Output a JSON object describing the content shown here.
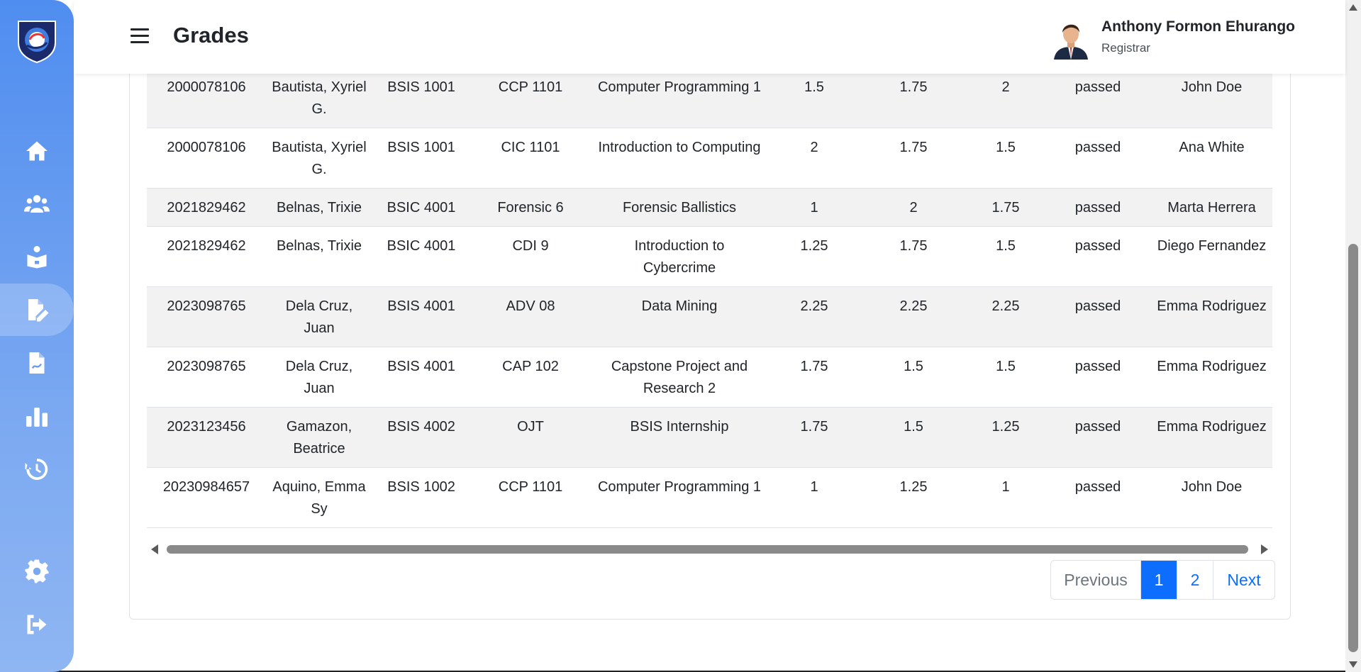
{
  "header": {
    "title": "Grades",
    "user_name": "Anthony Formon Ehurango",
    "user_role": "Registrar"
  },
  "sidebar": {
    "items": [
      {
        "icon": "home-icon"
      },
      {
        "icon": "users-icon"
      },
      {
        "icon": "reader-icon"
      },
      {
        "icon": "grades-edit-icon",
        "active": true
      },
      {
        "icon": "report-icon"
      },
      {
        "icon": "chart-bar-icon"
      },
      {
        "icon": "history-icon"
      },
      {
        "icon": "gear-icon"
      },
      {
        "icon": "logout-icon"
      }
    ]
  },
  "table": {
    "rows": [
      {
        "id": "2000078106",
        "name": "Bautista, Xyriel G.",
        "section": "BSIS 1001",
        "code": "CCP 1101",
        "subject": "Computer Programming 1",
        "g1": "1.5",
        "g2": "1.75",
        "g3": "2",
        "status": "passed",
        "instructor": "John Doe"
      },
      {
        "id": "2000078106",
        "name": "Bautista, Xyriel G.",
        "section": "BSIS 1001",
        "code": "CIC 1101",
        "subject": "Introduction to Computing",
        "g1": "2",
        "g2": "1.75",
        "g3": "1.5",
        "status": "passed",
        "instructor": "Ana White"
      },
      {
        "id": "2021829462",
        "name": "Belnas, Trixie",
        "section": "BSIC 4001",
        "code": "Forensic 6",
        "subject": "Forensic Ballistics",
        "g1": "1",
        "g2": "2",
        "g3": "1.75",
        "status": "passed",
        "instructor": "Marta Herrera"
      },
      {
        "id": "2021829462",
        "name": "Belnas, Trixie",
        "section": "BSIC 4001",
        "code": "CDI 9",
        "subject": "Introduction to Cybercrime",
        "g1": "1.25",
        "g2": "1.75",
        "g3": "1.5",
        "status": "passed",
        "instructor": "Diego Fernandez"
      },
      {
        "id": "2023098765",
        "name": "Dela Cruz, Juan",
        "section": "BSIS 4001",
        "code": "ADV 08",
        "subject": "Data Mining",
        "g1": "2.25",
        "g2": "2.25",
        "g3": "2.25",
        "status": "passed",
        "instructor": "Emma Rodriguez"
      },
      {
        "id": "2023098765",
        "name": "Dela Cruz, Juan",
        "section": "BSIS 4001",
        "code": "CAP 102",
        "subject": "Capstone Project and Research 2",
        "g1": "1.75",
        "g2": "1.5",
        "g3": "1.5",
        "status": "passed",
        "instructor": "Emma Rodriguez"
      },
      {
        "id": "2023123456",
        "name": "Gamazon, Beatrice",
        "section": "BSIS 4002",
        "code": "OJT",
        "subject": "BSIS Internship",
        "g1": "1.75",
        "g2": "1.5",
        "g3": "1.25",
        "status": "passed",
        "instructor": "Emma Rodriguez"
      },
      {
        "id": "20230984657",
        "name": "Aquino, Emma Sy",
        "section": "BSIS 1002",
        "code": "CCP 1101",
        "subject": "Computer Programming 1",
        "g1": "1",
        "g2": "1.25",
        "g3": "1",
        "status": "passed",
        "instructor": "John Doe"
      }
    ]
  },
  "pagination": {
    "previous": "Previous",
    "pages": [
      "1",
      "2"
    ],
    "current": "1",
    "next": "Next"
  },
  "colors": {
    "primary": "#0d6efd",
    "sidebar_top": "#4f8df0",
    "sidebar_bottom": "#8fb6f3",
    "stripe": "#f2f2f2"
  }
}
